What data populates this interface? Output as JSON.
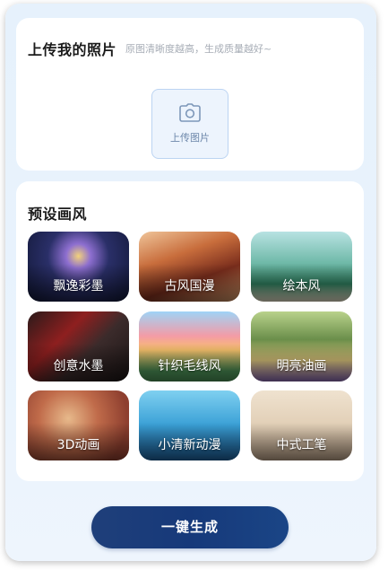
{
  "upload": {
    "title": "上传我的照片",
    "hint": "原图清晰度越高，生成质量越好~",
    "button_label": "上传图片",
    "icon": "camera-icon"
  },
  "styles": {
    "title": "预设画风",
    "items": [
      {
        "label": "飘逸彩墨"
      },
      {
        "label": "古风国漫"
      },
      {
        "label": "绘本风"
      },
      {
        "label": "创意水墨"
      },
      {
        "label": "针织毛线风"
      },
      {
        "label": "明亮油画"
      },
      {
        "label": "3D动画"
      },
      {
        "label": "小清新动漫"
      },
      {
        "label": "中式工笔"
      }
    ]
  },
  "generate": {
    "label": "一键生成"
  },
  "colors": {
    "accent": "#16397a",
    "upload_border": "#bcd4f2",
    "background": "#e8f2fc"
  }
}
